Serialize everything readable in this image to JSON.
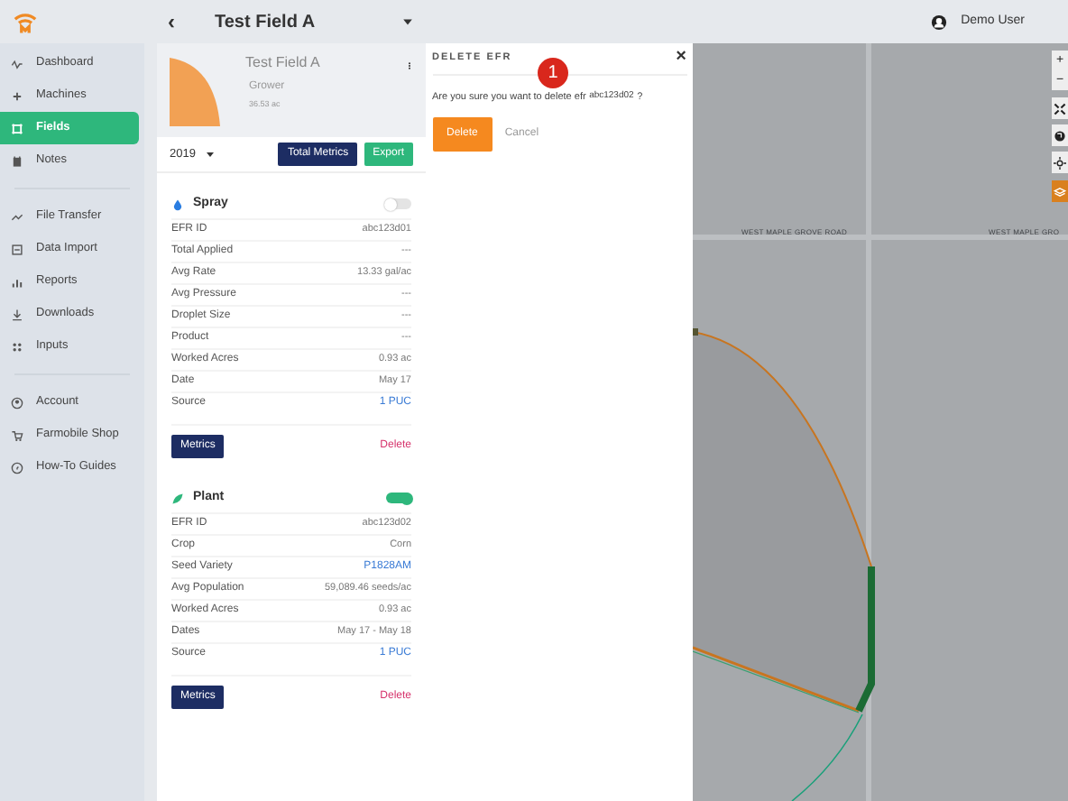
{
  "header": {
    "back": "‹",
    "title": "Test Field A",
    "user": "Demo User"
  },
  "sidebar": {
    "groups": [
      [
        {
          "label": "Dashboard",
          "selected": false
        },
        {
          "label": "Machines",
          "selected": false
        },
        {
          "label": "Fields",
          "selected": true
        },
        {
          "label": "Notes",
          "selected": false
        }
      ],
      [
        {
          "label": "File Transfer",
          "selected": false
        },
        {
          "label": "Data Import",
          "selected": false
        },
        {
          "label": "Reports",
          "selected": false
        },
        {
          "label": "Downloads",
          "selected": false
        },
        {
          "label": "Inputs",
          "selected": false
        }
      ],
      [
        {
          "label": "Account",
          "selected": false
        },
        {
          "label": "Farmobile Shop",
          "selected": false
        },
        {
          "label": "How-To Guides",
          "selected": false
        }
      ]
    ]
  },
  "field": {
    "name": "Test Field A",
    "grower": "Grower",
    "acres": "36.53 ac",
    "year": "2019",
    "total_metrics": "Total Metrics",
    "export": "Export"
  },
  "efrs": [
    {
      "kind": "spray",
      "title": "Spray",
      "on": false,
      "rows": [
        {
          "label": "EFR ID",
          "value": "abc123d01",
          "link": false
        },
        {
          "label": "Total Applied",
          "value": "---",
          "link": false
        },
        {
          "label": "Avg Rate",
          "value": "13.33 gal/ac",
          "link": false
        },
        {
          "label": "Avg Pressure",
          "value": "---",
          "link": false
        },
        {
          "label": "Droplet Size",
          "value": "---",
          "link": false
        },
        {
          "label": "Product",
          "value": "---",
          "link": false
        },
        {
          "label": "Worked Acres",
          "value": "0.93 ac",
          "link": false
        },
        {
          "label": "Date",
          "value": "May 17",
          "link": false
        },
        {
          "label": "Source",
          "value": "1 PUC",
          "link": true
        }
      ],
      "metrics": "Metrics",
      "delete": "Delete"
    },
    {
      "kind": "plant",
      "title": "Plant",
      "on": true,
      "rows": [
        {
          "label": "EFR ID",
          "value": "abc123d02",
          "link": false
        },
        {
          "label": "Crop",
          "value": "Corn",
          "link": false
        },
        {
          "label": "Seed Variety",
          "value": "P1828AM",
          "link": true
        },
        {
          "label": "Avg Population",
          "value": "59,089.46 seeds/ac",
          "link": false
        },
        {
          "label": "Worked Acres",
          "value": "0.93 ac",
          "link": false
        },
        {
          "label": "Dates",
          "value": "May 17 - May 18",
          "link": false
        },
        {
          "label": "Source",
          "value": "1 PUC",
          "link": true
        }
      ],
      "metrics": "Metrics",
      "delete": "Delete"
    }
  ],
  "dialog": {
    "title": "DELETE EFR",
    "close": "×",
    "message": "Are you sure you want to delete efr",
    "efr_id": "abc123d02",
    "question": "?",
    "delete": "Delete",
    "cancel": "Cancel"
  },
  "step_marker": "1",
  "map": {
    "zoom_in": "+",
    "zoom_out": "−",
    "road_labels": [
      "WEST MAPLE GROVE ROAD",
      "WEST MAPLE GRO"
    ]
  }
}
